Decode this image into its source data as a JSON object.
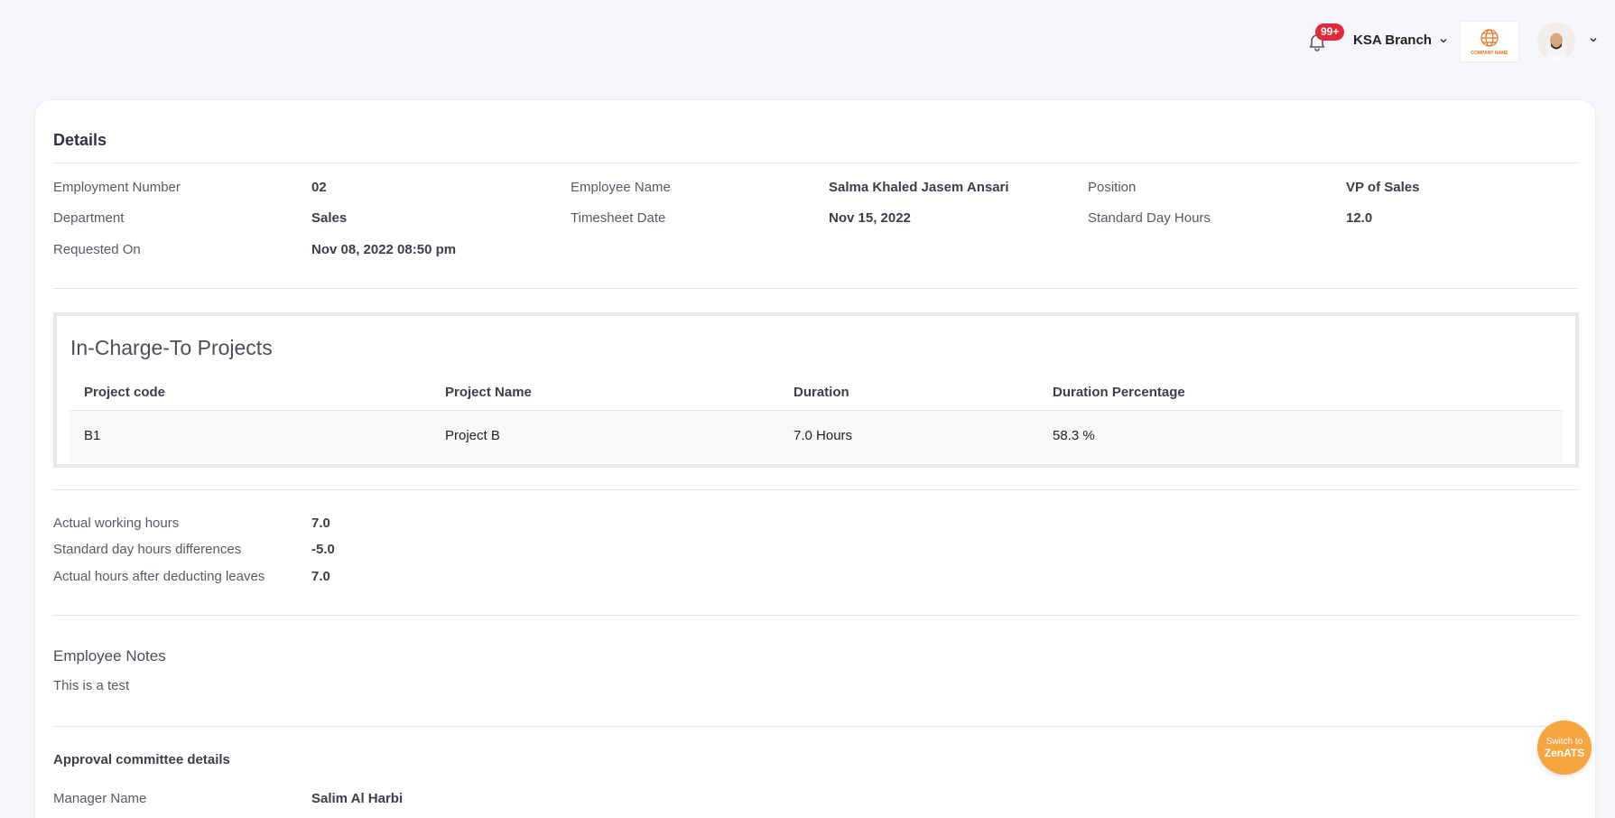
{
  "header": {
    "notification_count": "99+",
    "branch_label": "KSA Branch",
    "company_logo_text": "COMPANY NAME"
  },
  "details": {
    "title": "Details",
    "fields": {
      "employment_number_label": "Employment Number",
      "employment_number_value": "02",
      "employee_name_label": "Employee Name",
      "employee_name_value": "Salma Khaled Jasem Ansari",
      "position_label": "Position",
      "position_value": "VP of Sales",
      "department_label": "Department",
      "department_value": "Sales",
      "timesheet_date_label": "Timesheet Date",
      "timesheet_date_value": "Nov 15, 2022",
      "standard_day_hours_label": "Standard Day Hours",
      "standard_day_hours_value": "12.0",
      "requested_on_label": "Requested On",
      "requested_on_value": "Nov 08, 2022 08:50 pm"
    }
  },
  "projects": {
    "title": "In-Charge-To Projects",
    "columns": [
      "Project code",
      "Project Name",
      "Duration",
      "Duration Percentage"
    ],
    "rows": [
      [
        "B1",
        "Project B",
        "7.0 Hours",
        "58.3 %"
      ]
    ]
  },
  "hours": {
    "actual_working_label": "Actual working hours",
    "actual_working_value": "7.0",
    "difference_label": "Standard day hours differences",
    "difference_value": "-5.0",
    "after_leaves_label": "Actual hours after deducting leaves",
    "after_leaves_value": "7.0"
  },
  "notes": {
    "title": "Employee Notes",
    "text": "This is a test"
  },
  "approval": {
    "title": "Approval committee details",
    "manager_label": "Manager Name",
    "manager_value": "Salim Al Harbi"
  },
  "switch_button": {
    "line1": "Switch to",
    "line2": "ZenATS"
  },
  "colors": {
    "accent_orange": "#f7a540",
    "badge_red": "#e3293b",
    "background": "#f5f7fb"
  }
}
